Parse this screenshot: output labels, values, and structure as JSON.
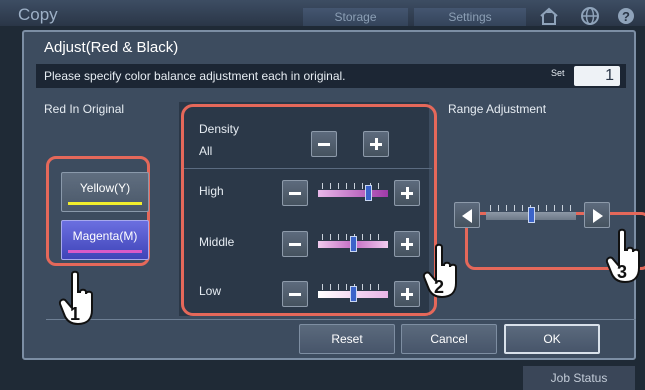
{
  "app": {
    "title": "Copy",
    "tabs": [
      "Storage",
      "Settings"
    ],
    "icons": [
      "home-icon",
      "globe-icon",
      "help-icon"
    ],
    "job_status": "Job Status"
  },
  "dialog": {
    "title": "Adjust(Red & Black)",
    "message": "Please specify color balance adjustment each in original.",
    "set_label": "Set",
    "set_value": "1",
    "red_in_original": {
      "label": "Red In Original",
      "options": [
        {
          "label": "Yellow(Y)",
          "stripe_color": "#f2ee2c"
        },
        {
          "label": "Magenta(M)",
          "stripe_color": "#d95ac8",
          "selected": true
        }
      ]
    },
    "density": {
      "label": "Density",
      "sub_label": "All",
      "rows": [
        {
          "label": "High",
          "level": 0.75
        },
        {
          "label": "Middle",
          "level": 0.5
        },
        {
          "label": "Low",
          "level": 0.5
        }
      ]
    },
    "range_adjustment": {
      "label": "Range Adjustment",
      "level": 0.5
    },
    "buttons": {
      "reset": "Reset",
      "cancel": "Cancel",
      "ok": "OK"
    }
  },
  "callouts": [
    "1",
    "2",
    "3"
  ],
  "colors": {
    "highlight": "#e5685a",
    "selected_button": "#4e53cc",
    "dialog_bg": "#3d4c5f"
  }
}
